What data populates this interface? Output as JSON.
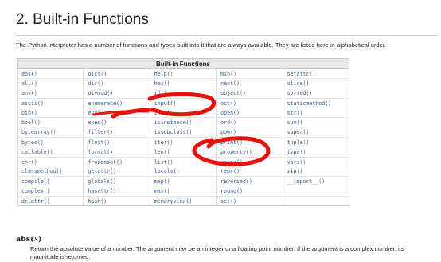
{
  "section": {
    "title": "2. Built-in Functions",
    "intro": "The Python interpreter has a number of functions and types built into it that are always available. They are listed here in alphabetical order."
  },
  "table": {
    "header": "Built-in Functions",
    "rows": [
      [
        "abs()",
        "dict()",
        "help()",
        "min()",
        "setattr()"
      ],
      [
        "all()",
        "dir()",
        "hex()",
        "next()",
        "slice()"
      ],
      [
        "any()",
        "divmod()",
        "id()",
        "object()",
        "sorted()"
      ],
      [
        "ascii()",
        "enumerate()",
        "input()",
        "oct()",
        "staticmethod()"
      ],
      [
        "bin()",
        "eval()",
        "int()",
        "open()",
        "str()"
      ],
      [
        "bool()",
        "exec()",
        "isinstance()",
        "ord()",
        "sum()"
      ],
      [
        "bytearray()",
        "filter()",
        "issubclass()",
        "pow()",
        "super()"
      ],
      [
        "bytes()",
        "float()",
        "iter()",
        "print()",
        "tuple()"
      ],
      [
        "callable()",
        "format()",
        "len()",
        "property()",
        "type()"
      ],
      [
        "chr()",
        "frozenset()",
        "list()",
        "range()",
        "vars()"
      ],
      [
        "classmethod()",
        "getattr()",
        "locals()",
        "repr()",
        "zip()"
      ],
      [
        "compile()",
        "globals()",
        "map()",
        "reversed()",
        "__import__()"
      ],
      [
        "complex()",
        "hasattr()",
        "max()",
        "round()",
        ""
      ],
      [
        "delattr()",
        "hash()",
        "memoryview()",
        "set()",
        ""
      ]
    ]
  },
  "function_doc": {
    "name": "abs",
    "arg": "x",
    "description": "Return the absolute value of a number. The argument may be an integer or a floating point number. If the argument is a complex number, its magnitude is returned."
  },
  "colors": {
    "link": "#3a5d8f",
    "annotation": "#e8120c"
  },
  "annotations": {
    "circled": [
      "input()",
      "print()"
    ]
  }
}
